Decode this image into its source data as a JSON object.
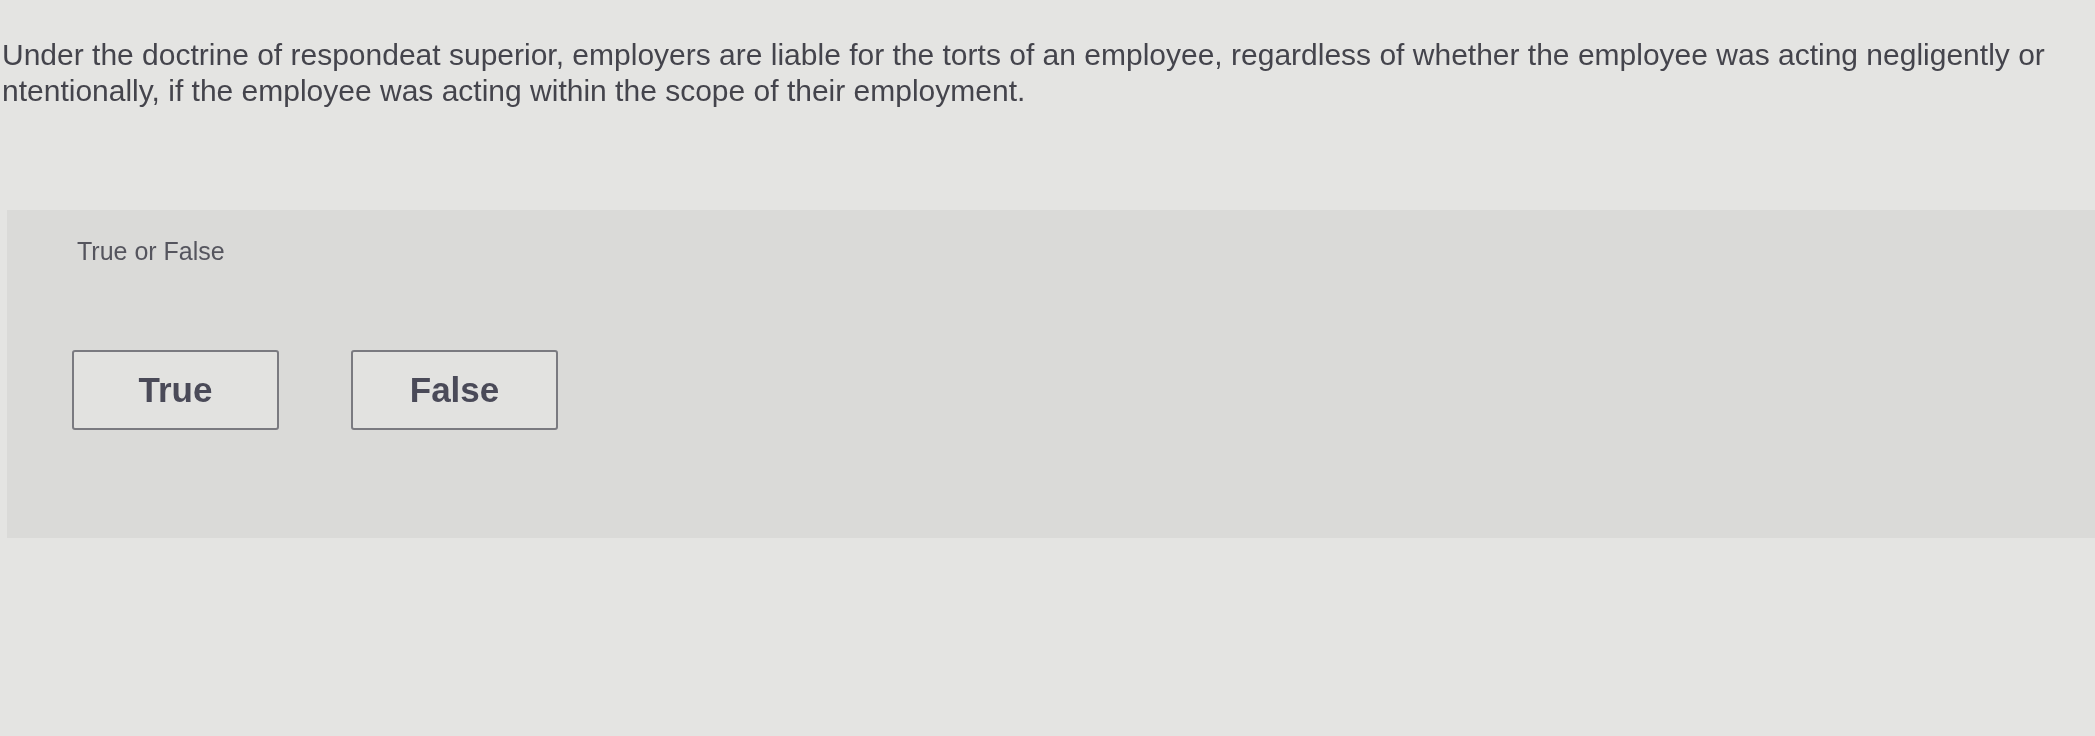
{
  "question": {
    "text": "Under the doctrine of respondeat superior, employers are liable for the torts of an employee, regardless of whether the employee was acting negligently or ntentionally, if the employee was acting within the scope of their employment."
  },
  "prompt": "True or False",
  "options": [
    {
      "label": "True",
      "selected": false
    },
    {
      "label": "False",
      "selected": false
    }
  ]
}
